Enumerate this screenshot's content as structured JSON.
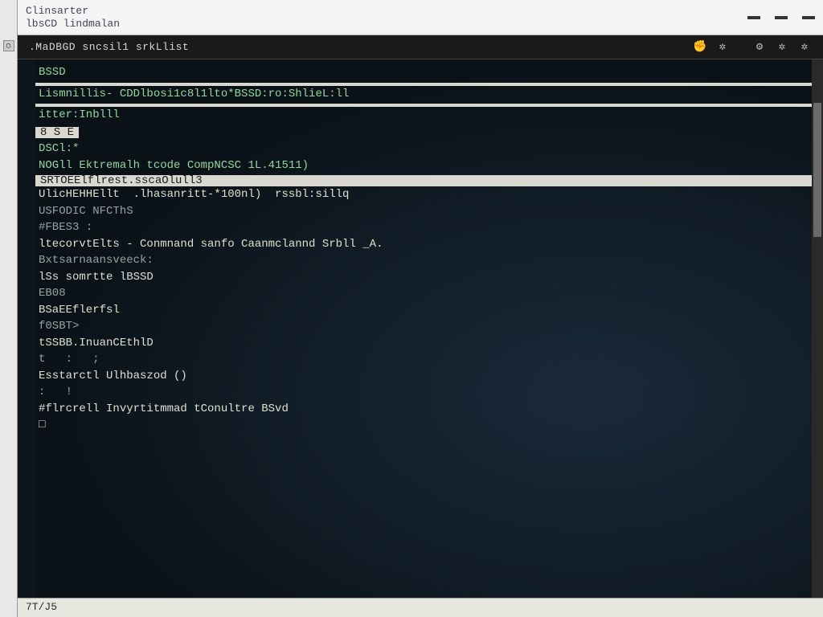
{
  "titlebar": {
    "line1": "Clinsarter",
    "line2": "lbsCD lindmalan"
  },
  "menubar": {
    "label": ".MaDBGD sncsil1 srkLlist",
    "icons": [
      "hand",
      "gear1",
      "sep",
      "gear2",
      "gear3",
      "gear4"
    ]
  },
  "terminal": {
    "lines": [
      {
        "t": "BSSD",
        "cls": "green"
      },
      {
        "t": "",
        "bar": true
      },
      {
        "t": "Lismnillis- CDDlbosi1c8l1lto*BSSD:ro:ShlieL:ll",
        "cls": "green"
      },
      {
        "t": "",
        "bar": true
      },
      {
        "t": "itter:Inblll",
        "cls": "green"
      },
      {
        "t": "8 S E",
        "bar": true,
        "thin": true,
        "half": true
      },
      {
        "t": "DSCl:*",
        "cls": "green"
      },
      {
        "t": "NOGll Ektremalh tcode CompNCSC 1L.41511)",
        "cls": "green"
      },
      {
        "t": "SRTOEElflrest.sscaOlull3",
        "bar": true,
        "thin": true
      },
      {
        "t": "UlicHEHHEllt  .lhasanritt-*100nl)  rssbl:sillq",
        "cls": ""
      },
      {
        "t": "USFODIC NFCThS",
        "cls": "dim"
      },
      {
        "t": "#FBES3 :",
        "cls": "dim"
      },
      {
        "t": "ltecorvtElts - Conmnand sanfo Caanmclannd Srbll _A.",
        "cls": ""
      },
      {
        "t": "Bxtsarnaansveeck:",
        "cls": "dim"
      },
      {
        "t": "lSs somrtte lBSSD",
        "cls": ""
      },
      {
        "t": "EB08",
        "cls": "dim"
      },
      {
        "t": "BSaEEflerfsl",
        "cls": ""
      },
      {
        "t": "f0SBT>",
        "cls": "dim"
      },
      {
        "t": "tSSBB.InuanCEthlD",
        "cls": ""
      },
      {
        "t": "t   :   ;",
        "cls": "dim"
      },
      {
        "t": "Esstarctl Ulhbaszod ()",
        "cls": ""
      },
      {
        "t": ":   !",
        "cls": "dim"
      },
      {
        "t": "#flrcrell Invyrtitmmad tConultre BSvd",
        "cls": ""
      },
      {
        "t": "□",
        "cls": ""
      }
    ]
  },
  "status": "7T/J5",
  "linegutter": "- - - - - - - - - - - - - - - - - - - - - - - - - - - -"
}
